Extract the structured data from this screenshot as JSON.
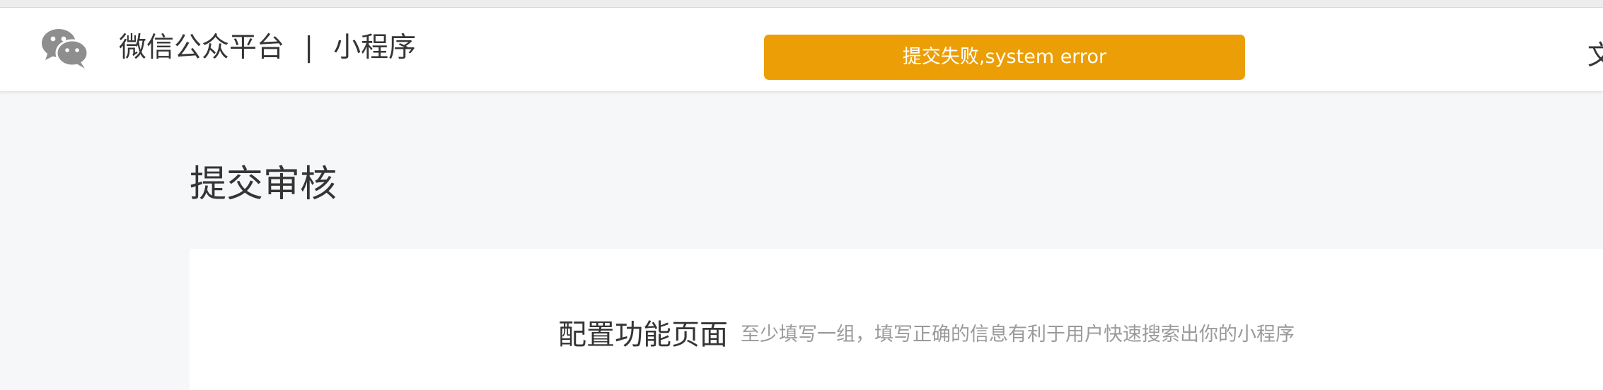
{
  "header": {
    "logo_icon": "wechat-icon",
    "brand": "微信公众平台",
    "separator": "|",
    "product": "小程序",
    "right_text": "文"
  },
  "toast": {
    "message": "提交失败,system error",
    "color": "#eb9e05"
  },
  "page": {
    "title": "提交审核"
  },
  "section": {
    "title": "配置功能页面",
    "hint": "至少填写一组，填写正确的信息有利于用户快速搜索出你的小程序"
  }
}
